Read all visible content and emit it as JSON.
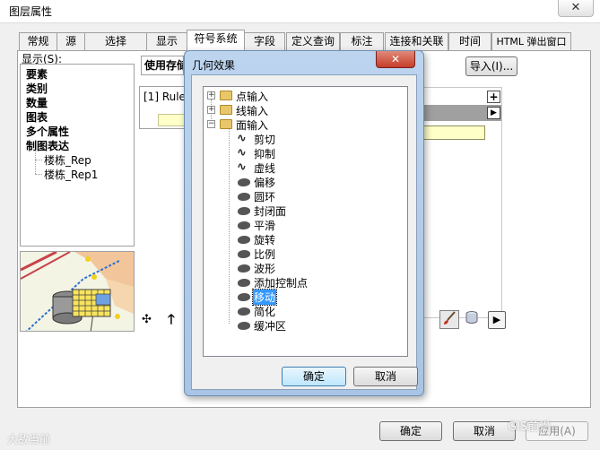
{
  "outer_window": {
    "title": "图层属性",
    "close_glyph": "✕",
    "tabs": [
      {
        "label": "常规"
      },
      {
        "label": "源"
      },
      {
        "label": "选择"
      },
      {
        "label": "显示"
      },
      {
        "label": "符号系统",
        "active": true
      },
      {
        "label": "字段"
      },
      {
        "label": "定义查询"
      },
      {
        "label": "标注"
      },
      {
        "label": "连接和关联"
      },
      {
        "label": "时间"
      },
      {
        "label": "HTML 弹出窗口"
      }
    ],
    "show_label": "显示(S):",
    "show_items": [
      {
        "label": "要素",
        "bold": true
      },
      {
        "label": "类别",
        "bold": true
      },
      {
        "label": "数量",
        "bold": true
      },
      {
        "label": "图表",
        "bold": true
      },
      {
        "label": "多个属性",
        "bold": true
      },
      {
        "label": "制图表达",
        "bold": true
      },
      {
        "label": "楼栋_Rep",
        "bold": false
      },
      {
        "label": "楼栋_Rep1",
        "bold": false
      }
    ],
    "main_label": "使用存储",
    "import_button": "导入(I)...",
    "rule_text": "[1] Rule_",
    "plus_glyph": "+",
    "play_glyph": "▶",
    "add_glyph": "✣",
    "up_glyph": "🡑",
    "next_glyph": "▶",
    "ok_button": "确定",
    "cancel_button": "取消",
    "apply_button": "应用(A)"
  },
  "dialog": {
    "title": "几何效果",
    "close_glyph": "✕",
    "tree": {
      "groups": [
        {
          "label": "点输入",
          "expander": "+"
        },
        {
          "label": "线输入",
          "expander": "+"
        },
        {
          "label": "面输入",
          "expander": "−"
        }
      ],
      "children": [
        {
          "label": "剪切",
          "icon": "line"
        },
        {
          "label": "抑制",
          "icon": "line"
        },
        {
          "label": "虚线",
          "icon": "line"
        },
        {
          "label": "偏移",
          "icon": "blob"
        },
        {
          "label": "圆环",
          "icon": "blob"
        },
        {
          "label": "封闭面",
          "icon": "blob"
        },
        {
          "label": "平滑",
          "icon": "blob"
        },
        {
          "label": "旋转",
          "icon": "blob"
        },
        {
          "label": "比例",
          "icon": "blob"
        },
        {
          "label": "波形",
          "icon": "blob"
        },
        {
          "label": "添加控制点",
          "icon": "blob"
        },
        {
          "label": "移动",
          "icon": "blob",
          "selected": true
        },
        {
          "label": "简化",
          "icon": "blob"
        },
        {
          "label": "缓冲区",
          "icon": "blob"
        }
      ]
    },
    "ok_button": "确定",
    "cancel_button": "取消"
  },
  "watermarks": {
    "left": "大敌当前",
    "right": "GIS前沿"
  },
  "colors": {
    "dialog_frame": "#a9c4e4",
    "close_red": "#c63d2a",
    "selected_blue": "#3399ff"
  }
}
